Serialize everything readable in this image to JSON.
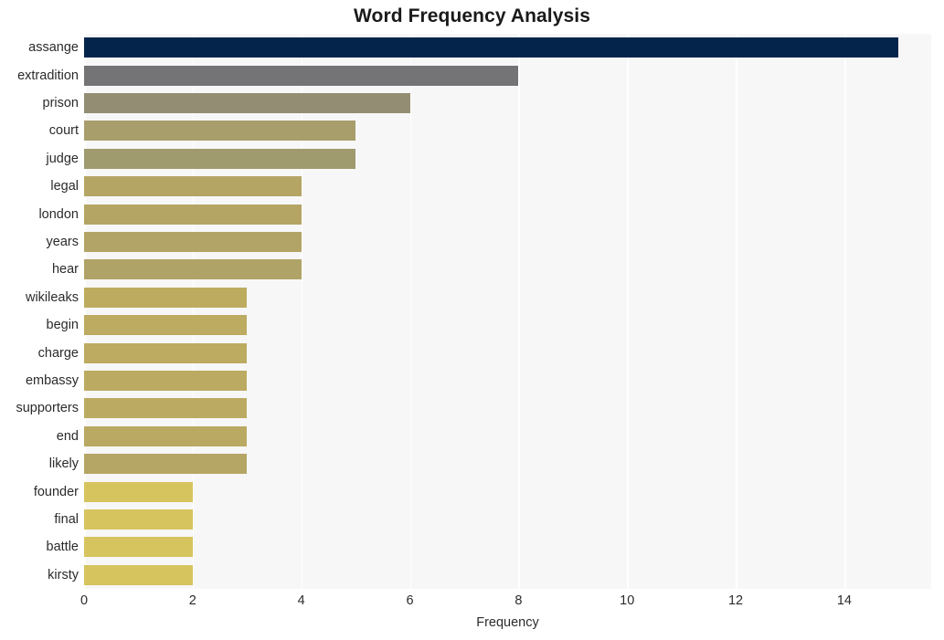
{
  "chart_data": {
    "type": "bar",
    "orientation": "horizontal",
    "title": "Word Frequency Analysis",
    "xlabel": "Frequency",
    "ylabel": "",
    "categories": [
      "assange",
      "extradition",
      "prison",
      "court",
      "judge",
      "legal",
      "london",
      "years",
      "hear",
      "wikileaks",
      "begin",
      "charge",
      "embassy",
      "supporters",
      "end",
      "likely",
      "founder",
      "final",
      "battle",
      "kirsty"
    ],
    "values": [
      15,
      8,
      6,
      5,
      5,
      4,
      4,
      4,
      4,
      3,
      3,
      3,
      3,
      3,
      3,
      3,
      2,
      2,
      2,
      2
    ],
    "bar_colors": [
      "#04244c",
      "#747476",
      "#938e73",
      "#a89e6c",
      "#a09a6f",
      "#b5a564",
      "#b4a564",
      "#b2a466",
      "#b0a367",
      "#bdac5f",
      "#bcab60",
      "#bcab60",
      "#bbaa61",
      "#bbaa61",
      "#baa962",
      "#b6a665",
      "#d6c45e",
      "#d6c45e",
      "#d6c45e",
      "#d6c45e"
    ],
    "xlim": [
      0,
      15.6
    ],
    "xticks": [
      0,
      2,
      4,
      6,
      8,
      10,
      12,
      14
    ],
    "xtick_labels": [
      "0",
      "2",
      "4",
      "6",
      "8",
      "10",
      "12",
      "14"
    ],
    "grid": "vertical",
    "grid_color": "#ffffff",
    "plot_background": "#f7f7f8",
    "figure_background": "#ffffff",
    "legend": null
  }
}
